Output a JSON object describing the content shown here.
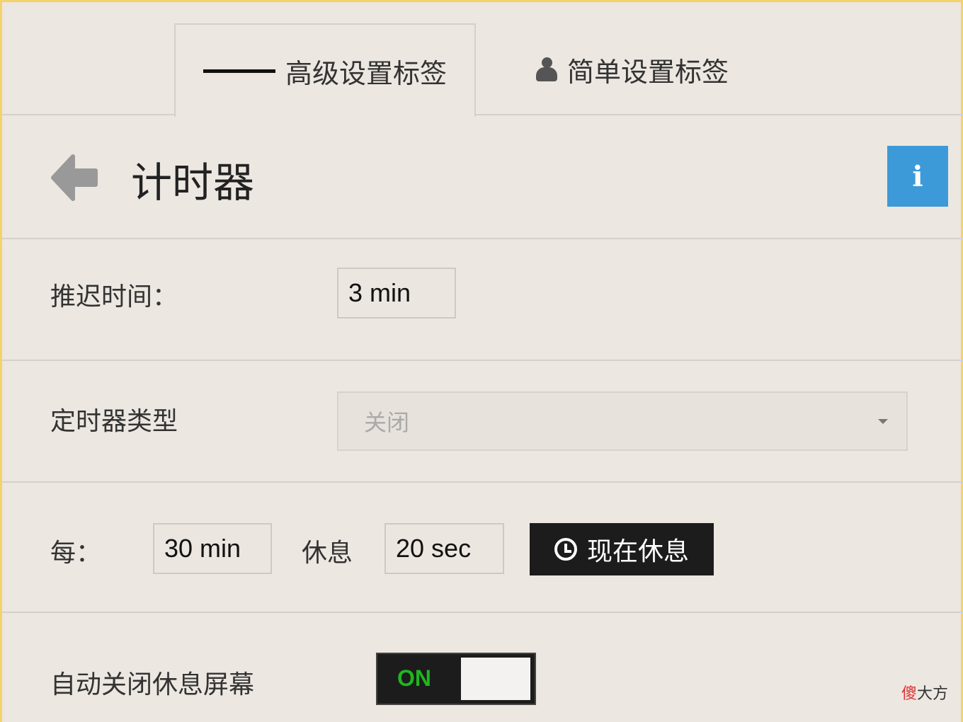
{
  "tabs": {
    "advanced_label": "高级设置标签",
    "simple_label": "简单设置标签"
  },
  "header": {
    "title": "计时器",
    "info_label": "i"
  },
  "delay": {
    "label": "推迟时间：",
    "value": "3 min"
  },
  "timer_type": {
    "label": "定时器类型",
    "selected": "关闭"
  },
  "every": {
    "label": "每：",
    "interval": "30 min",
    "rest_label": "休息",
    "rest_duration": "20 sec",
    "rest_now_label": "现在休息"
  },
  "auto_close": {
    "label": "自动关闭休息屏幕",
    "toggle_label": "ON",
    "toggle_state": true
  },
  "watermark": {
    "first": "傻",
    "rest": "大方"
  },
  "colors": {
    "accent_info": "#3d9ad8",
    "toggle_on_text": "#1fb61f",
    "button_dark": "#1c1c1c"
  }
}
